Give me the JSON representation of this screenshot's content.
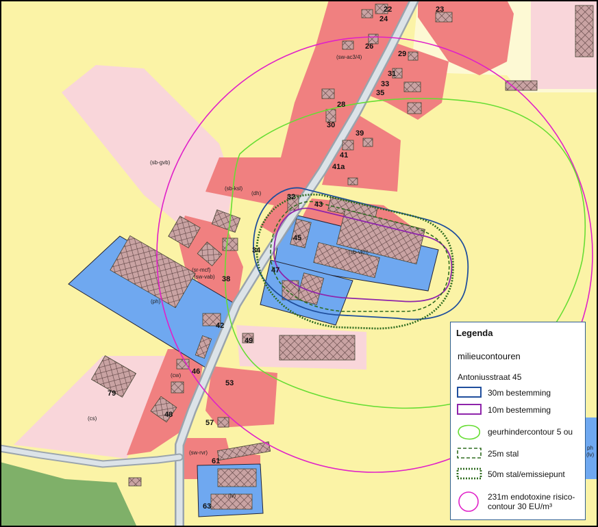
{
  "map": {
    "house_numbers": [
      "22",
      "23",
      "24",
      "26",
      "29",
      "31",
      "33",
      "35",
      "28",
      "30",
      "39",
      "41",
      "41a",
      "32",
      "43",
      "45",
      "34",
      "47",
      "38",
      "42",
      "49",
      "46",
      "53",
      "79",
      "48",
      "57",
      "61",
      "63"
    ],
    "zone_codes": [
      "(sw-ac3/4)",
      "(sb-gvb)",
      "(sb-ksl)",
      "(dh)",
      "(sb-vkh)",
      "(sr-mcf)",
      "(sw-vab)",
      "(ph)",
      "(cw)",
      "(cs)",
      "(sw-rvr)",
      "(lv)",
      "ph",
      "(lv)"
    ]
  },
  "legend": {
    "title": "Legenda",
    "subtitle": "milieucontouren",
    "group": "Antoniusstraat 45",
    "items": [
      {
        "label": "30m bestemming",
        "color": "#1f4e9c"
      },
      {
        "label": "10m bestemming",
        "color": "#8e24aa"
      },
      {
        "label": "geurhindercontour 5 ou",
        "color": "#66dd33"
      },
      {
        "label": "25m stal",
        "color": "#2e6b1f"
      },
      {
        "label": "50m stal/emissiepunt",
        "color": "#2e6b1f"
      },
      {
        "label": "231m endotoxine risico-contour 30 EU/m³",
        "color": "#e020c8"
      }
    ]
  }
}
